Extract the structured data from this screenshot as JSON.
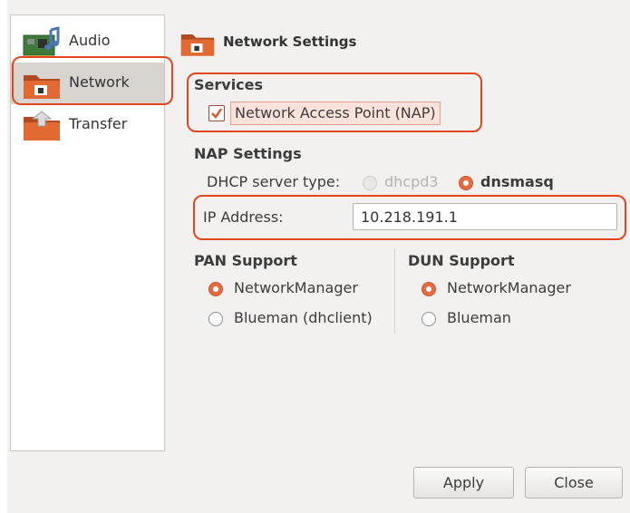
{
  "sidebar": {
    "items": [
      {
        "label": "Audio",
        "icon": "audio-card-icon"
      },
      {
        "label": "Network",
        "icon": "network-folder-icon"
      },
      {
        "label": "Transfer",
        "icon": "transfer-folder-icon"
      }
    ],
    "selected": "Network"
  },
  "header": {
    "title": "Network Settings",
    "icon": "network-folder-icon"
  },
  "services": {
    "title": "Services",
    "nap_label": "Network Access Point (NAP)",
    "nap_checked": true
  },
  "nap_settings": {
    "title": "NAP Settings",
    "dhcp_label": "DHCP server type:",
    "dhcp_options": [
      "dhcpd3",
      "dnsmasq"
    ],
    "dhcp_selected": "dnsmasq",
    "ip_label": "IP Address:",
    "ip_value": "10.218.191.1"
  },
  "pan_support": {
    "title": "PAN Support",
    "options": [
      "NetworkManager",
      "Blueman (dhclient)"
    ],
    "selected": "NetworkManager"
  },
  "dun_support": {
    "title": "DUN Support",
    "options": [
      "NetworkManager",
      "Blueman"
    ],
    "selected": "NetworkManager"
  },
  "buttons": {
    "apply": "Apply",
    "close": "Close"
  },
  "colors": {
    "accent": "#e56b43",
    "highlight_border": "#e3461f",
    "window_bg": "#f2f1f0"
  }
}
